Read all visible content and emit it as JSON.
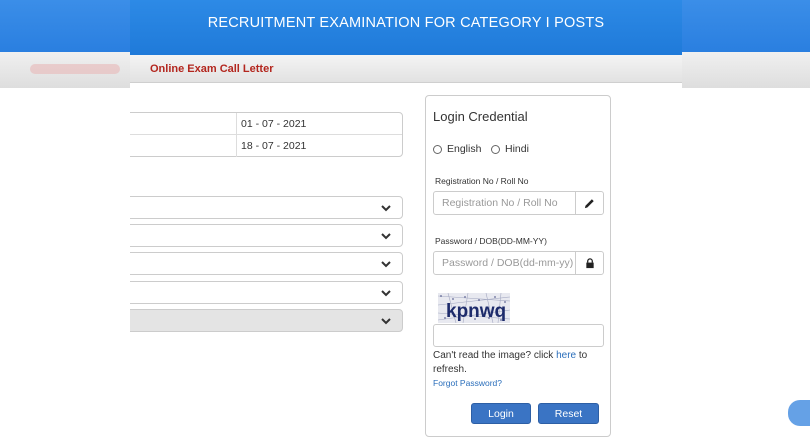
{
  "header": {
    "title": "RECRUITMENT EXAMINATION FOR CATEGORY I POSTS"
  },
  "subbar": {
    "title": "Online Exam Call Letter"
  },
  "dates": [
    {
      "value": "01 - 07 - 2021"
    },
    {
      "value": "18 - 07 - 2021"
    }
  ],
  "selects": [
    {
      "disabled": false
    },
    {
      "disabled": false
    },
    {
      "disabled": false
    },
    {
      "disabled": false
    },
    {
      "disabled": true
    }
  ],
  "login": {
    "title": "Login Credential",
    "languages": [
      "English",
      "Hindi"
    ],
    "registration_label": "Registration No / Roll No",
    "registration_placeholder": "Registration No / Roll No",
    "password_label": "Password / DOB(DD-MM-YY)",
    "password_placeholder": "Password / DOB(dd-mm-yy)",
    "captcha_text": "kpnwq",
    "refresh_prefix": "Can't read the image? click ",
    "refresh_link": "here",
    "refresh_suffix": " to refresh.",
    "forgot_password": "Forgot Password?",
    "login_button": "Login",
    "reset_button": "Reset"
  },
  "colors": {
    "header_blue": "#2d8ae6",
    "subbar_red": "#b3261e",
    "button_blue": "#3a74c4",
    "link_blue": "#2a6ebb"
  }
}
